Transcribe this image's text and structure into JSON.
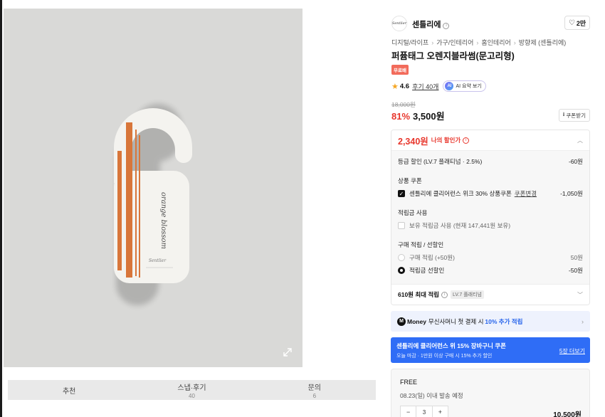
{
  "colors": {
    "accent_red": "#e8362c",
    "coupon_blue": "#2f6df6",
    "money_bg": "#eef2fd",
    "free_badge": "#f26b5b",
    "tag_orange": "#d8763a"
  },
  "product_image": {
    "tag_text": "orange blossom",
    "tag_brand": "Sentlier",
    "expand_icon": "expand-icon"
  },
  "tabs": [
    {
      "label": "추천",
      "count": ""
    },
    {
      "label": "스냅·후기",
      "count": "40"
    },
    {
      "label": "문의",
      "count": "6"
    }
  ],
  "brand": {
    "logo_text": "Sentlier",
    "name": "센틀리에",
    "info": "i",
    "like_icon": "heart-icon",
    "like_count": "2만"
  },
  "breadcrumb": [
    "디지털/라이프",
    "가구/인테리어",
    "홈인테리어",
    "방향제 (센틀리에)"
  ],
  "title": "퍼퓸태그 오렌지블라썸(문고리형)",
  "free_badge": "무료배",
  "rating": {
    "score": "4.6",
    "reviews_label": "후기 40개",
    "ai_badge": "AI",
    "ai_label": "AI 요약 보기"
  },
  "price": {
    "original": "18,000원",
    "discount": "81%",
    "current": "3,500원",
    "coupon_button": "쿠폰받기"
  },
  "benefits": {
    "my_price": "2,340원",
    "my_price_label": "나의 할인가",
    "grade_discount_label": "등급 할인 (LV.7 플래티넘 · 2.5%)",
    "grade_discount_value": "-60원",
    "coupon_heading": "상품 쿠폰",
    "coupon_item": "센틀리에 클리어런스 위크 30% 상품쿠폰",
    "coupon_change": "쿠폰변경",
    "coupon_value": "-1,050원",
    "points_heading": "적립금 사용",
    "points_item": "보유 적립금 사용 (현재 147,441원 보유)",
    "purchase_heading": "구매 적립 / 선할인",
    "opt_earn_label": "구매 적립 (+50원)",
    "opt_earn_value": "50원",
    "opt_pre_label": "적립금 선할인",
    "opt_pre_value": "-50원",
    "max_label": "610원 최대 적립",
    "grade_tag": "LV.7 플래티넘"
  },
  "money_bar": {
    "icon": "M",
    "brand": "Money",
    "text_before": "무신사머니 첫 결제 시",
    "highlight": "10% 추가 적립"
  },
  "blue_coupon": {
    "title": "센틀리에 클리어런스 위 15% 장바구니 쿠폰",
    "subtitle": "오늘 마감 · 1만원 이상 구매 시 15% 추가 할인",
    "link": "5장 더보기"
  },
  "option": {
    "name": "FREE",
    "shipping": "08.23(일) 이내 발송 예정",
    "qty": "3",
    "minus": "−",
    "plus": "+",
    "total": "10,500원"
  }
}
